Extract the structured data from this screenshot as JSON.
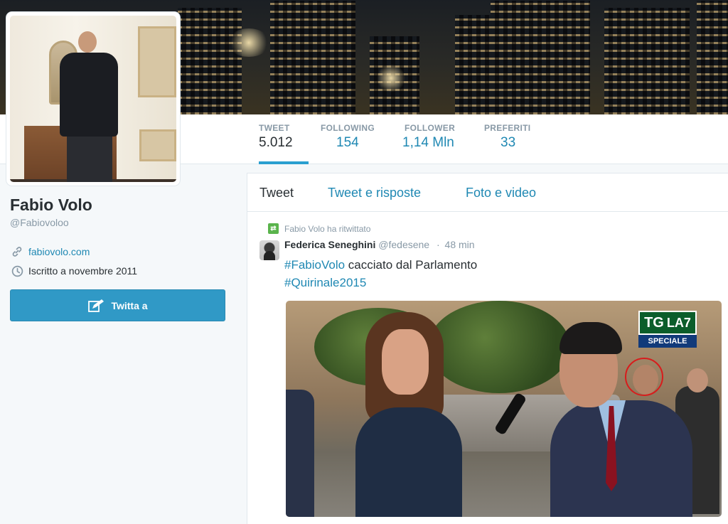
{
  "profile": {
    "name": "Fabio Volo",
    "handle": "@Fabiovoloo",
    "website": "fabiovolo.com",
    "joined": "Iscritto a novembre 2011",
    "tweet_to_label": "Twitta a"
  },
  "stats": [
    {
      "label": "TWEET",
      "value": "5.012",
      "active": true
    },
    {
      "label": "FOLLOWING",
      "value": "154",
      "active": false
    },
    {
      "label": "FOLLOWER",
      "value": "1,14 Mln",
      "active": false
    },
    {
      "label": "PREFERITI",
      "value": "33",
      "active": false
    }
  ],
  "timeline_tabs": [
    {
      "label": "Tweet",
      "active": true
    },
    {
      "label": "Tweet e risposte",
      "active": false
    },
    {
      "label": "Foto e video",
      "active": false
    }
  ],
  "tweet": {
    "retweet_context": "Fabio Volo ha ritwittato",
    "author_name": "Federica Seneghini",
    "author_handle": "@fedesene",
    "separator": "·",
    "time": "48 min",
    "hashtag1": "#FabioVolo",
    "text_mid": " cacciato dal Parlamento",
    "hashtag2": "#Quirinale2015"
  },
  "media_logo": {
    "top": "TG",
    "top_small": "LA7",
    "bottom": "SPECIALE"
  },
  "colors": {
    "link": "#1f88b3",
    "button": "#3099c6",
    "background": "#f5f8fa",
    "retweet": "#5ab44c"
  },
  "icons": {
    "website": "link-icon",
    "joined": "clock-icon",
    "tweet_to": "compose-icon",
    "retweet": "retweet-icon"
  }
}
